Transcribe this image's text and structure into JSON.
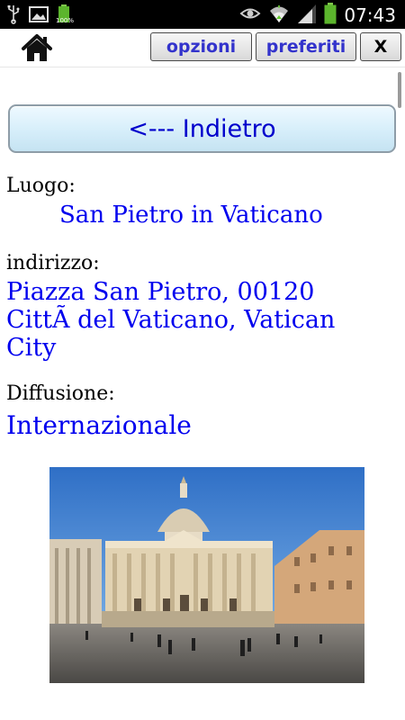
{
  "status_bar": {
    "time": "07:43",
    "battery_percent": "100%",
    "icons": [
      "usb-icon",
      "image-icon",
      "battery-small-icon",
      "eye-icon",
      "wifi-icon",
      "signal-icon",
      "battery-icon"
    ]
  },
  "toolbar": {
    "home_icon": "home-icon",
    "options_label": "opzioni",
    "favorites_label": "preferiti",
    "close_label": "X"
  },
  "back_button": {
    "label": "<--- Indietro"
  },
  "details": {
    "place_label": "Luogo:",
    "place_value": "San Pietro in Vaticano",
    "address_label": "indirizzo:",
    "address_value": "Piazza San Pietro, 00120 CittÃ  del Vaticano, Vatican City",
    "spread_label": "Diffusione:",
    "spread_value": "Internazionale"
  },
  "colors": {
    "link_blue": "#0000ee",
    "toolbar_text": "#3333cc",
    "status_bar": "#000000"
  }
}
